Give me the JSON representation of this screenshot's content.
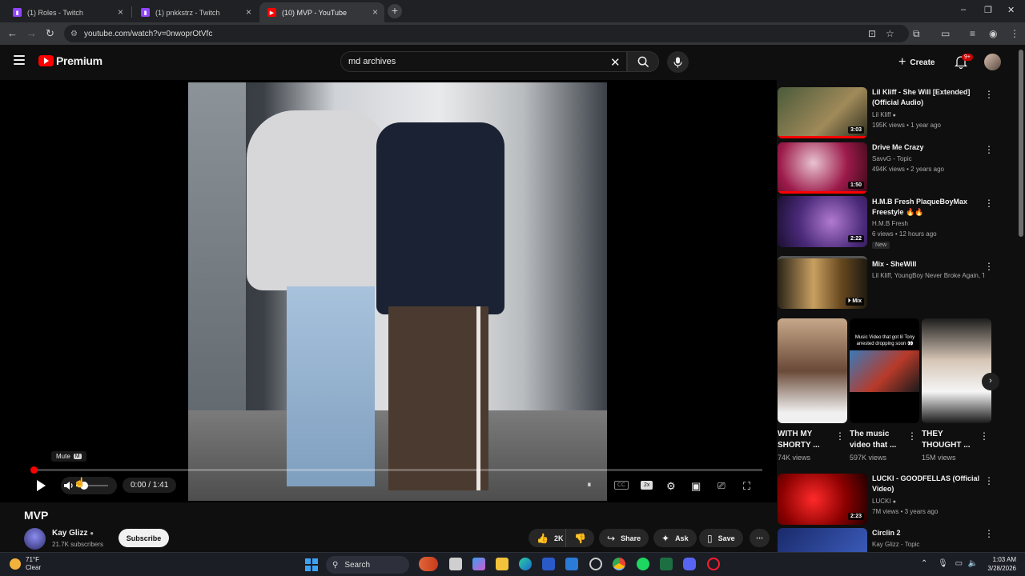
{
  "browser": {
    "tabs": [
      {
        "title": "(1) Roles - Twitch",
        "favicon": "twitch-icon",
        "active": false
      },
      {
        "title": "(1) pnkkstrz - Twitch",
        "favicon": "twitch-icon",
        "active": false
      },
      {
        "title": "(10) MVP - YouTube",
        "favicon": "youtube-icon",
        "active": true
      }
    ],
    "url": "youtube.com/watch?v=0nwoprOtVfc"
  },
  "masthead": {
    "logo_text": "Premium",
    "search_value": "md archives",
    "create_label": "Create",
    "notification_badge": "9+"
  },
  "player": {
    "tooltip_label": "Mute",
    "tooltip_key": "M",
    "time_display": "0:00 / 1:41",
    "speed_label": "2x",
    "cc_label": "CC",
    "progress": 0.0,
    "volume": 0.25
  },
  "video": {
    "title": "MVP",
    "channel": "Kay Glizz",
    "subscribers": "21.7K subscribers",
    "subscribe_label": "Subscribe",
    "likes": "2K",
    "share_label": "Share",
    "ask_label": "Ask",
    "save_label": "Save"
  },
  "recommendations": [
    {
      "title": "Lil Kliff - She Will [Extended] (Official Audio)",
      "channel": "Lil Kliff",
      "meta": "195K views • 1 year ago",
      "duration": "3:03",
      "verified": true
    },
    {
      "title": "Drive Me Crazy",
      "channel": "SavvG - Topic",
      "meta": "494K views • 2 years ago",
      "duration": "1:50",
      "verified": false
    },
    {
      "title": "H.M.B Fresh PlaqueBoyMax Freestyle 🔥🔥",
      "channel": "H.M.B Fresh",
      "meta": "6 views • 12 hours ago",
      "duration": "2:22",
      "badge": "New"
    },
    {
      "title": "Mix - SheWill",
      "channel": "Lil Kliff, YoungBoy Never Broke Again, To...",
      "meta": "",
      "duration": "Mix"
    }
  ],
  "shorts": [
    {
      "title": "WITH MY SHORTY ...",
      "views": "74K views"
    },
    {
      "title": "The music video that ...",
      "views": "597K views",
      "overlay": "Music Video that got lil Tony arrested dropping soon 👀"
    },
    {
      "title": "THEY THOUGHT ...",
      "views": "15M views"
    }
  ],
  "recommendations2": [
    {
      "title": "LUCKI - GOODFELLAS (Official Video)",
      "channel": "LUCKI",
      "meta": "7M views • 3 years ago",
      "duration": "2:23"
    },
    {
      "title": "Circlin 2",
      "channel": "Kay Glizz - Topic",
      "meta": ""
    }
  ],
  "taskbar": {
    "temperature": "71°F",
    "condition": "Clear",
    "search_label": "Search",
    "time": "1:03 AM",
    "date": "3/28/2026"
  },
  "colors": {
    "accent": "#ff0000",
    "background": "#0f0f0f",
    "surface": "#272727"
  }
}
